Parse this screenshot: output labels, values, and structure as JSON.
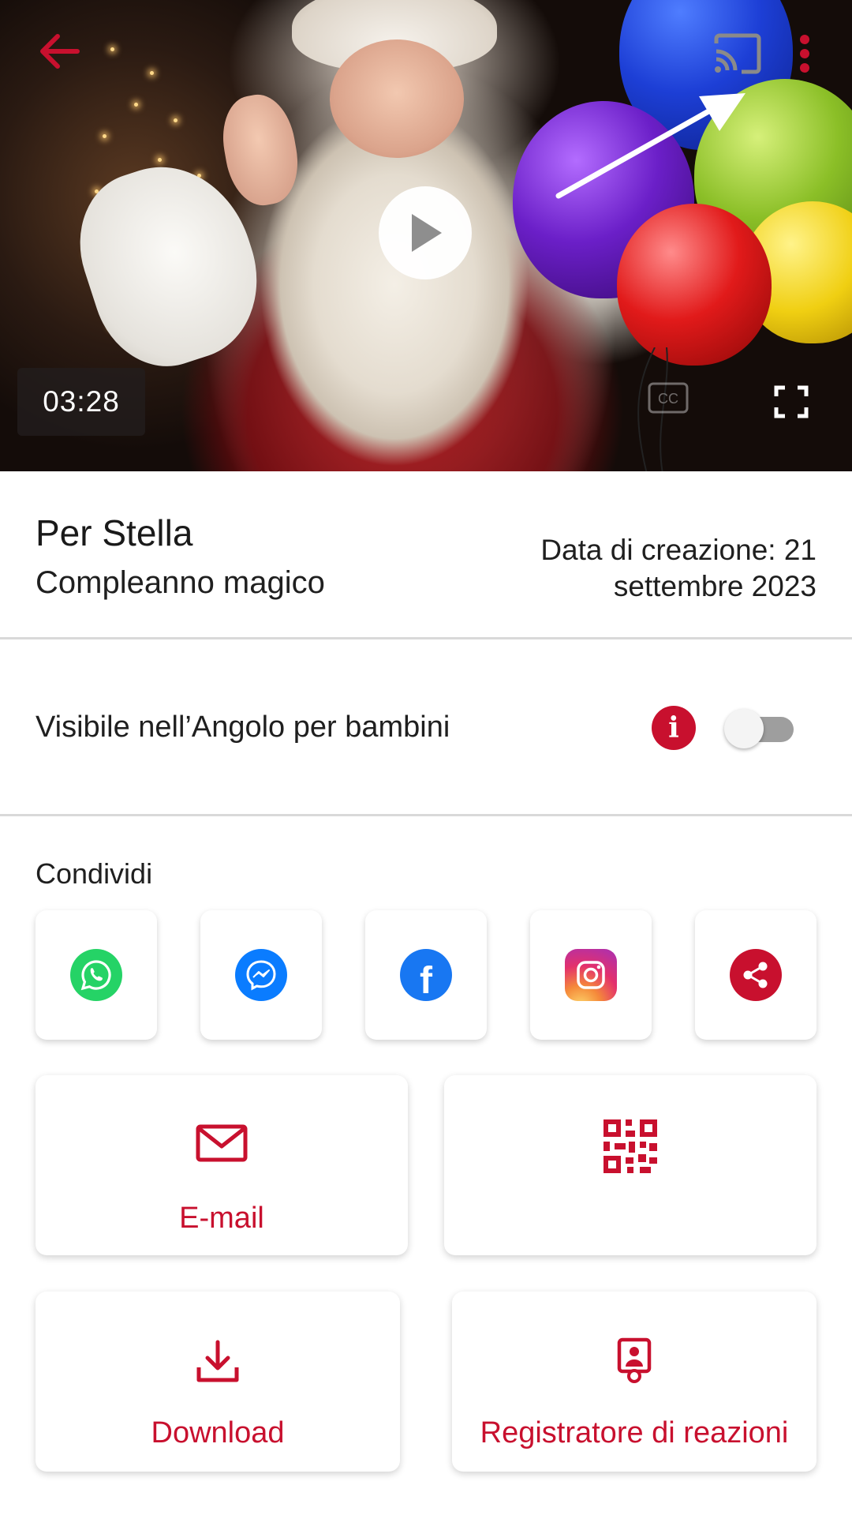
{
  "video": {
    "duration": "03:28",
    "icons": [
      "back-arrow-icon",
      "cast-icon",
      "more-vert-icon",
      "play-icon",
      "fullscreen-icon",
      "closed-captions-icon"
    ]
  },
  "info": {
    "title": "Per Stella",
    "subtitle": "Compleanno magico",
    "date_line1": "Data di creazione: 21",
    "date_line2": "settembre 2023"
  },
  "kids_corner": {
    "label": "Visibile nell’Angolo per bambini",
    "enabled": false
  },
  "share": {
    "label": "Condividi",
    "targets": [
      "whatsapp",
      "messenger",
      "facebook",
      "instagram",
      "share"
    ]
  },
  "actions": {
    "email_label": "E-mail",
    "qr_label": "",
    "download_label": "Download",
    "reaction_label": "Registratore di reazioni"
  },
  "colors": {
    "accent": "#c8102e",
    "whatsapp": "#25d366",
    "messenger": "#0a7cff",
    "facebook": "#1877f2"
  }
}
